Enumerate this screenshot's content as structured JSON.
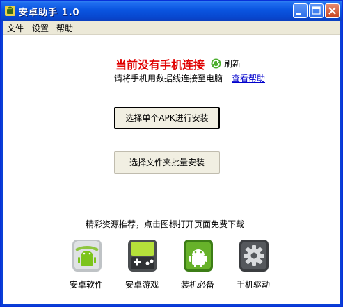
{
  "window": {
    "title": "安卓助手 1.0"
  },
  "menu": {
    "items": [
      "文件",
      "设置",
      "帮助"
    ]
  },
  "status": {
    "title": "当前没有手机连接",
    "refresh_label": "刷新",
    "hint": "请将手机用数据线连接至电脑",
    "help_link": "查看帮助"
  },
  "actions": {
    "install_single": "选择单个APK进行安装",
    "install_folder": "选择文件夹批量安装"
  },
  "resources": {
    "heading": "精彩资源推荐，点击图标打开页面免费下载",
    "items": [
      {
        "label": "安卓软件",
        "icon": "android-software-icon"
      },
      {
        "label": "安卓游戏",
        "icon": "android-game-icon"
      },
      {
        "label": "装机必备",
        "icon": "essential-apps-icon"
      },
      {
        "label": "手机驱动",
        "icon": "phone-driver-gear-icon"
      }
    ]
  },
  "colors": {
    "title_bar": "#0a55e0",
    "warning": "#e00000",
    "link": "#0000cc",
    "android_green": "#7cc41c"
  }
}
